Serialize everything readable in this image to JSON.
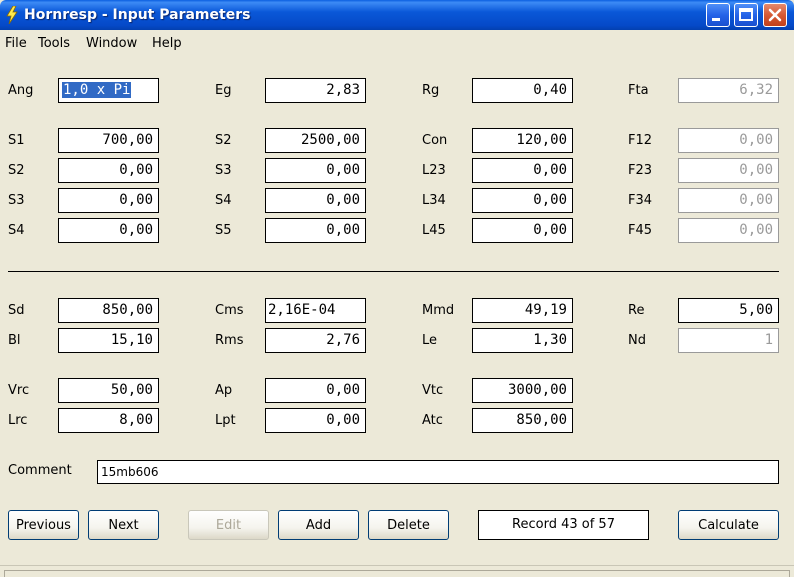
{
  "window": {
    "title": "Hornresp - Input Parameters"
  },
  "menu": [
    "File",
    "Tools",
    "Window",
    "Help"
  ],
  "params": {
    "ang": {
      "label": "Ang",
      "value": "1,0 x Pi"
    },
    "eg": {
      "label": "Eg",
      "value": "2,83"
    },
    "rg": {
      "label": "Rg",
      "value": "0,40"
    },
    "fta": {
      "label": "Fta",
      "value": "6,32"
    },
    "s1": {
      "label": "S1",
      "value": "700,00"
    },
    "s2b": {
      "label": "S2",
      "value": "2500,00"
    },
    "con": {
      "label": "Con",
      "value": "120,00"
    },
    "f12": {
      "label": "F12",
      "value": "0,00"
    },
    "s2": {
      "label": "S2",
      "value": "0,00"
    },
    "s3b": {
      "label": "S3",
      "value": "0,00"
    },
    "l23": {
      "label": "L23",
      "value": "0,00"
    },
    "f23": {
      "label": "F23",
      "value": "0,00"
    },
    "s3": {
      "label": "S3",
      "value": "0,00"
    },
    "s4b": {
      "label": "S4",
      "value": "0,00"
    },
    "l34": {
      "label": "L34",
      "value": "0,00"
    },
    "f34": {
      "label": "F34",
      "value": "0,00"
    },
    "s4": {
      "label": "S4",
      "value": "0,00"
    },
    "s5": {
      "label": "S5",
      "value": "0,00"
    },
    "l45": {
      "label": "L45",
      "value": "0,00"
    },
    "f45": {
      "label": "F45",
      "value": "0,00"
    },
    "sd": {
      "label": "Sd",
      "value": "850,00"
    },
    "cms": {
      "label": "Cms",
      "value": "2,16E-04"
    },
    "mmd": {
      "label": "Mmd",
      "value": "49,19"
    },
    "re": {
      "label": "Re",
      "value": "5,00"
    },
    "bl": {
      "label": "Bl",
      "value": "15,10"
    },
    "rms": {
      "label": "Rms",
      "value": "2,76"
    },
    "le": {
      "label": "Le",
      "value": "1,30"
    },
    "nd": {
      "label": "Nd",
      "value": "1"
    },
    "vrc": {
      "label": "Vrc",
      "value": "50,00"
    },
    "ap": {
      "label": "Ap",
      "value": "0,00"
    },
    "vtc": {
      "label": "Vtc",
      "value": "3000,00"
    },
    "lrc": {
      "label": "Lrc",
      "value": "8,00"
    },
    "lpt": {
      "label": "Lpt",
      "value": "0,00"
    },
    "atc": {
      "label": "Atc",
      "value": "850,00"
    }
  },
  "comment": {
    "label": "Comment",
    "value": "15mb606"
  },
  "buttons": {
    "previous": "Previous",
    "next": "Next",
    "edit": "Edit",
    "add": "Add",
    "delete": "Delete",
    "calculate": "Calculate"
  },
  "record": "Record 43 of 57"
}
